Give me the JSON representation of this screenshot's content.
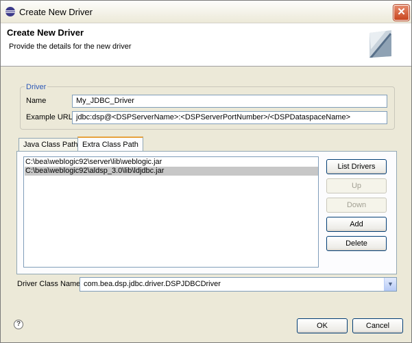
{
  "window": {
    "title": "Create New Driver",
    "close_label": "✕"
  },
  "header": {
    "title": "Create New Driver",
    "description": "Provide the details for the new driver"
  },
  "driver_group": {
    "legend": "Driver",
    "name_label": "Name",
    "name_value": "My_JDBC_Driver",
    "url_label": "Example URL",
    "url_value": "jdbc:dsp@<DSPServerName>:<DSPServerPortNumber>/<DSPDataspaceName>"
  },
  "tabs": [
    {
      "label": "Java Class Path",
      "active": false
    },
    {
      "label": "Extra Class Path",
      "active": true
    }
  ],
  "class_path_list": [
    {
      "path": "C:\\bea\\weblogic92\\server\\lib\\weblogic.jar",
      "selected": false
    },
    {
      "path": "C:\\bea\\weblogic92\\aldsp_3.0\\lib\\ldjdbc.jar",
      "selected": true
    }
  ],
  "side_buttons": {
    "list_drivers": "List Drivers",
    "up": "Up",
    "down": "Down",
    "add": "Add",
    "delete": "Delete"
  },
  "driver_class": {
    "label": "Driver Class Name",
    "value": "com.bea.dsp.jdbc.driver.DSPJDBCDriver"
  },
  "footer": {
    "help_glyph": "?",
    "ok_label": "OK",
    "cancel_label": "Cancel"
  },
  "icons": {
    "app": "eclipse-icon",
    "help": "help-icon",
    "close": "close-icon",
    "dropdown": "chevron-down-icon"
  },
  "colors": {
    "accent_tab": "#e7a13d",
    "legend_text": "#2b57b7",
    "selection": "#c7c7c7",
    "close_button": "#c8451f"
  }
}
